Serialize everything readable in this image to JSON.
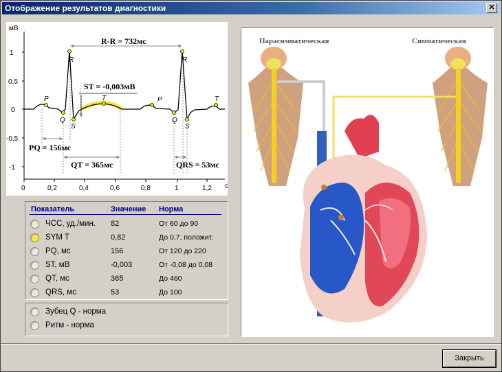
{
  "window": {
    "title": "Отображение результатов диагностики",
    "close_glyph": "✕"
  },
  "ecg": {
    "y_unit": "мВ",
    "x_unit": "с",
    "y_ticks": [
      "1",
      "0,5",
      "0",
      "-0,5",
      "-1"
    ],
    "x_ticks": [
      "0",
      "0,2",
      "0,4",
      "0,6",
      "0,8",
      "1",
      "1,2"
    ],
    "waves": [
      "P",
      "Q",
      "R",
      "S",
      "T"
    ],
    "rr": "R-R = 732мс",
    "st": "ST = -0,003мВ",
    "pq": "PQ = 156мс",
    "qt": "QT = 365мс",
    "qrs": "QRS = 53мс"
  },
  "params": {
    "headers": {
      "name": "Показатель",
      "value": "Значение",
      "norm": "Норма"
    },
    "rows": [
      {
        "name": "ЧСС, уд./мин.",
        "value": "82",
        "norm": "От 60 до 90",
        "selected": false
      },
      {
        "name": "SYM T",
        "value": "0,82",
        "norm": "До 0,7, положит.",
        "selected": true
      },
      {
        "name": "PQ, мс",
        "value": "156",
        "norm": "От 120 до 220",
        "selected": false
      },
      {
        "name": "ST, мВ",
        "value": "-0,003",
        "norm": "От -0,08 до 0,08",
        "selected": false
      },
      {
        "name": "QT, мс",
        "value": "365",
        "norm": "До 460",
        "selected": false
      },
      {
        "name": "QRS, мс",
        "value": "53",
        "norm": "До 100",
        "selected": false
      }
    ]
  },
  "flags": [
    {
      "label": "Зубец Q - норма"
    },
    {
      "label": "Ритм - норма"
    }
  ],
  "diagram": {
    "para_label": "Парасимпатическая",
    "sym_label": "Симпатическая"
  },
  "buttons": {
    "close": "Закрыть"
  },
  "colors": {
    "title_bar": "#0a246a",
    "selected_radio": "#f7ec2a",
    "highlight": "#f0e020"
  }
}
